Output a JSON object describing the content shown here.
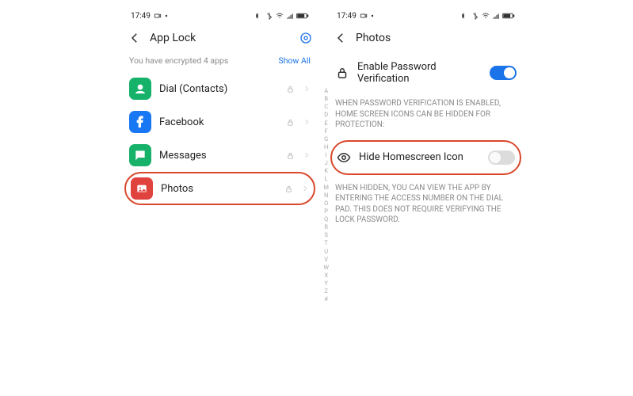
{
  "statusbar": {
    "time": "17:49"
  },
  "left": {
    "header_title": "App Lock",
    "subtitle": "You have encrypted 4 apps",
    "show_all": "Show All",
    "apps": [
      {
        "label": "Dial (Contacts)"
      },
      {
        "label": "Facebook"
      },
      {
        "label": "Messages"
      },
      {
        "label": "Photos"
      }
    ],
    "alpha_index": "A B C D E F G H I J K L M N O P Q R S T U V W X Y Z #"
  },
  "right": {
    "header_title": "Photos",
    "enable_pw_label": "Enable Password Verification",
    "caption1": "WHEN PASSWORD VERIFICATION IS ENABLED, HOME SCREEN ICONS CAN BE HIDDEN FOR PROTECTION:",
    "hide_icon_label": "Hide Homescreen Icon",
    "caption2": "WHEN HIDDEN, YOU CAN VIEW THE APP BY ENTERING THE ACCESS NUMBER ON THE DIAL PAD. THIS DOES NOT REQUIRE VERIFYING THE LOCK PASSWORD."
  }
}
